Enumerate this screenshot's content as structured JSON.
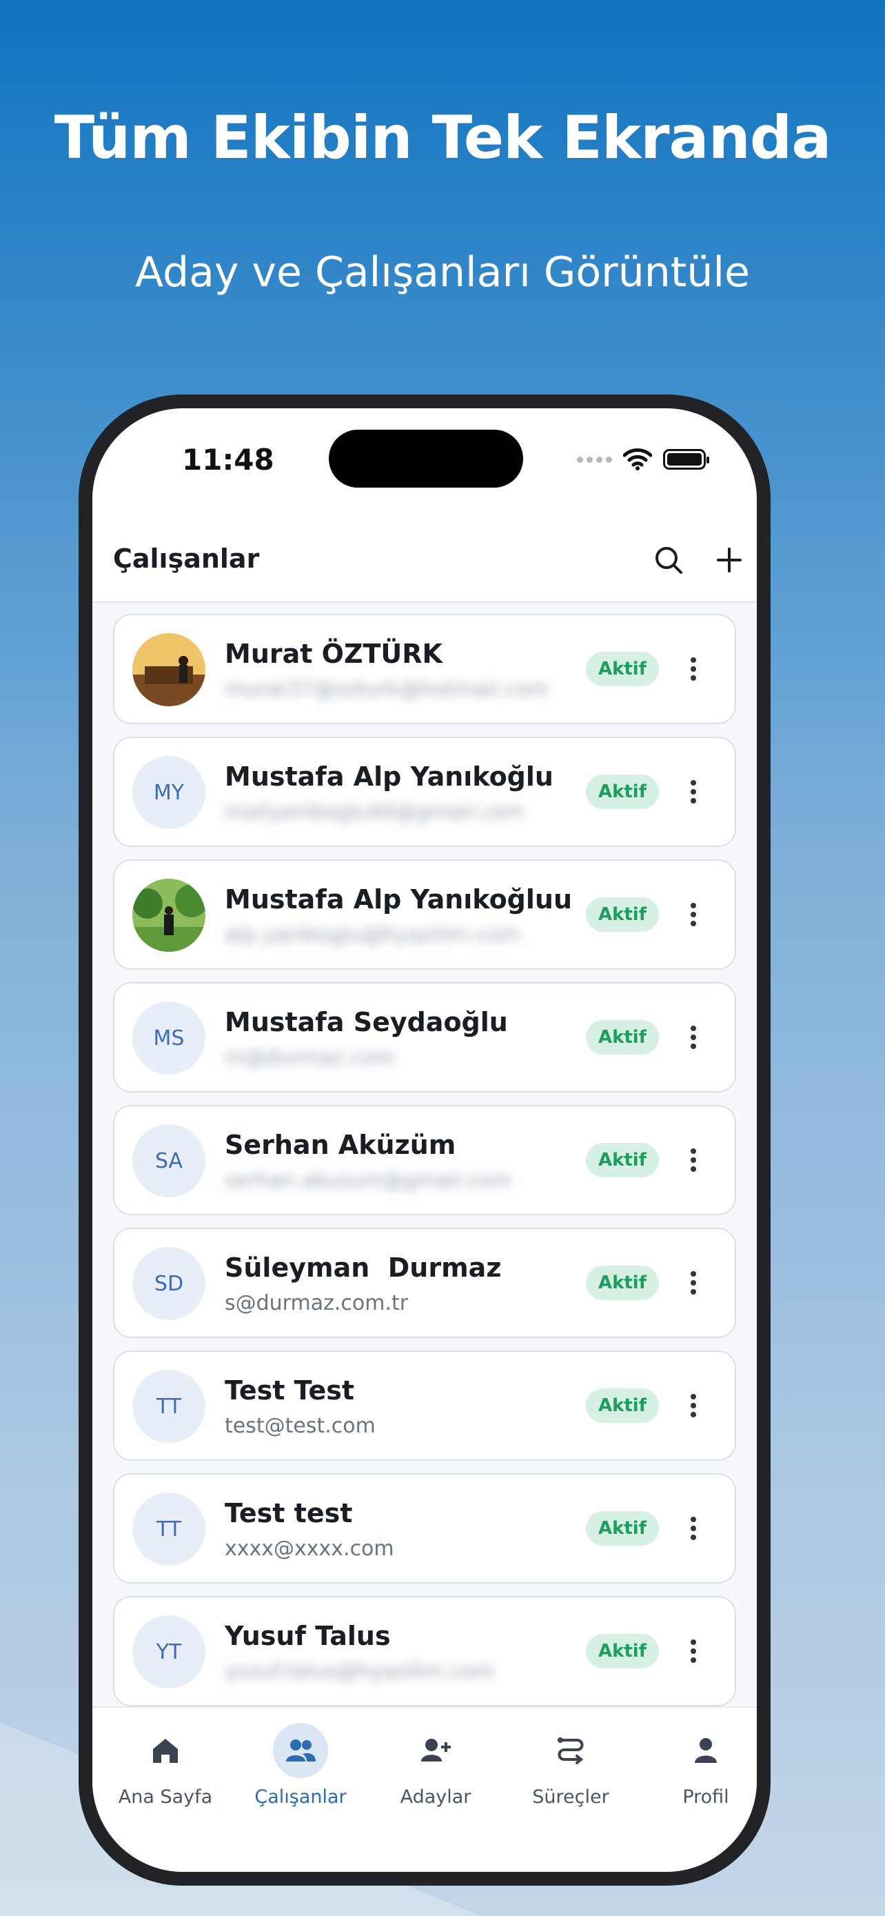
{
  "marketing": {
    "headline": "Tüm Ekibin Tek Ekranda",
    "subheadline": "Aday ve Çalışanları Görüntüle"
  },
  "status_bar": {
    "time": "11:48"
  },
  "header": {
    "title": "Çalışanlar",
    "search_icon": "search-icon",
    "add_icon": "plus-icon"
  },
  "employees": [
    {
      "name": "Murat ÖZTÜRK",
      "initials": "",
      "email": "murat37@ozturk@hotmail.com",
      "email_blurred": true,
      "status": "Aktif",
      "avatar": "photo"
    },
    {
      "name": "Mustafa Alp Yanıkoğlu",
      "initials": "MY",
      "email": "mailyanikoglu44@gmail.com",
      "email_blurred": true,
      "status": "Aktif",
      "avatar": "initials"
    },
    {
      "name": "Mustafa Alp Yanıkoğluu",
      "initials": "",
      "email": "alp.yanikoglu@hyazilim.com",
      "email_blurred": true,
      "status": "Aktif",
      "avatar": "photo"
    },
    {
      "name": "Mustafa Seydaoğlu",
      "initials": "MS",
      "email": "m@durmaz.com",
      "email_blurred": true,
      "status": "Aktif",
      "avatar": "initials"
    },
    {
      "name": "Serhan Aküzüm",
      "initials": "SA",
      "email": "serhan.akuzum@gmail.com",
      "email_blurred": true,
      "status": "Aktif",
      "avatar": "initials"
    },
    {
      "name": "Süleyman  Durmaz",
      "initials": "SD",
      "email": "s@durmaz.com.tr",
      "email_blurred": false,
      "status": "Aktif",
      "avatar": "initials"
    },
    {
      "name": "Test Test",
      "initials": "TT",
      "email": "test@test.com",
      "email_blurred": false,
      "status": "Aktif",
      "avatar": "initials"
    },
    {
      "name": "Test test",
      "initials": "TT",
      "email": "xxxx@xxxx.com",
      "email_blurred": false,
      "status": "Aktif",
      "avatar": "initials"
    },
    {
      "name": "Yusuf Talus",
      "initials": "YT",
      "email": "yusuf.talus@hyazilim.com",
      "email_blurred": true,
      "status": "Aktif",
      "avatar": "initials"
    }
  ],
  "tabs": [
    {
      "label": "Ana Sayfa",
      "icon": "home-icon",
      "active": false
    },
    {
      "label": "Çalışanlar",
      "icon": "users-icon",
      "active": true
    },
    {
      "label": "Adaylar",
      "icon": "user-plus-icon",
      "active": false
    },
    {
      "label": "Süreçler",
      "icon": "route-icon",
      "active": false
    },
    {
      "label": "Profil",
      "icon": "profile-icon",
      "active": false
    }
  ],
  "colors": {
    "accent": "#2b6cb0",
    "status_active_bg": "#d6f1e4",
    "status_active_text": "#1f9d5e",
    "avatar_bg": "#e8eef8"
  }
}
